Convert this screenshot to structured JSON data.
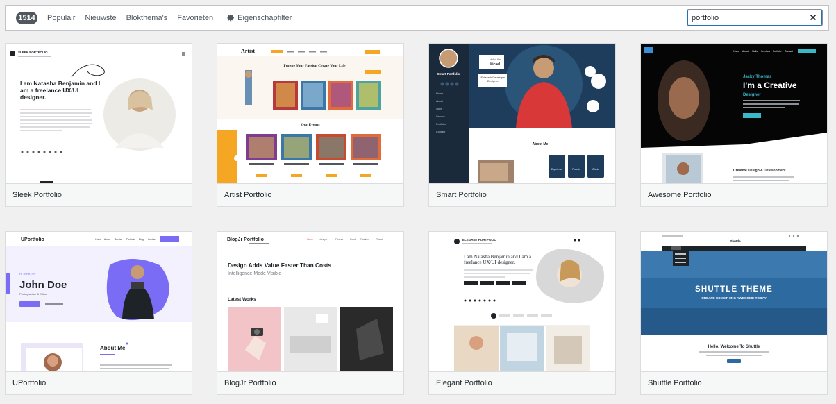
{
  "filter_bar": {
    "count": "1514",
    "tabs": [
      "Populair",
      "Nieuwste",
      "Blokthema's",
      "Favorieten"
    ],
    "feature_filter": "Eigenschapfilter",
    "search_value": "portfolio"
  },
  "themes": [
    {
      "name": "Sleek Portfolio",
      "preview": {
        "brand": "SLEEK PORTFOLIO",
        "heading": "I am Natasha Benjamin and I am a freelance UX/UI designer."
      }
    },
    {
      "name": "Artist Portfolio",
      "preview": {
        "brand": "Artist",
        "heading": "Pursue Your Passion Create Your Life",
        "section": "Our Events"
      }
    },
    {
      "name": "Smart Portfolio",
      "preview": {
        "brand": "Smart Portfolio",
        "greeting": "Hello, I'm",
        "name": "Micael",
        "subtitle": "Fullstack Developer Designer",
        "section": "About Me",
        "menu": [
          "Home",
          "About",
          "Skills",
          "Service",
          "Portfolio",
          "Contact"
        ],
        "stats": [
          "Experience",
          "Projects",
          "Clients"
        ]
      }
    },
    {
      "name": "Awesome Portfolio",
      "preview": {
        "person": "Jacky Thomas",
        "heading": "I'm a Creative",
        "role": "Designer",
        "section": "Creative Design & Development",
        "menu": [
          "Home",
          "About",
          "Skills",
          "Services",
          "Portfolio",
          "Contact"
        ]
      }
    },
    {
      "name": "UPortfolio",
      "preview": {
        "brand": "UPortfolio",
        "greeting": "Hi There, I'm",
        "name": "John Doe",
        "role": "Photographer & Editor",
        "section": "About Me",
        "menu": [
          "Home",
          "About",
          "Service",
          "Portfolio",
          "Blog",
          "Contact"
        ]
      }
    },
    {
      "name": "BlogJr Portfolio",
      "preview": {
        "brand": "BlogJr Portfolio",
        "heading": "Design Adds Value Faster Than Costs",
        "subheading": "Intelligence Made Visible",
        "section": "Latest Works",
        "menu": [
          "Home",
          "Lifestyle",
          "Fitness",
          "Food",
          "Fashion",
          "Travel"
        ]
      }
    },
    {
      "name": "Elegant Portfolio",
      "preview": {
        "brand": "ELEGANT PORTFOLIO",
        "heading": "I am Natasha Benjamin and I am a freelance UX/UI designer."
      }
    },
    {
      "name": "Shuttle Portfolio",
      "preview": {
        "brand": "Shuttle",
        "heading": "SHUTTLE THEME",
        "subheading": "CREATE SOMETHING AWESOME TODAY",
        "welcome": "Hello, Welcome To Shuttle"
      }
    }
  ],
  "colors": {
    "accent": "#2271b1",
    "badge": "#50575e",
    "artist_orange": "#f5a623",
    "smart_navy": "#1b2a3a",
    "uportfolio_purple": "#7b6cf6",
    "shuttle_blue": "#2d6aa0"
  }
}
